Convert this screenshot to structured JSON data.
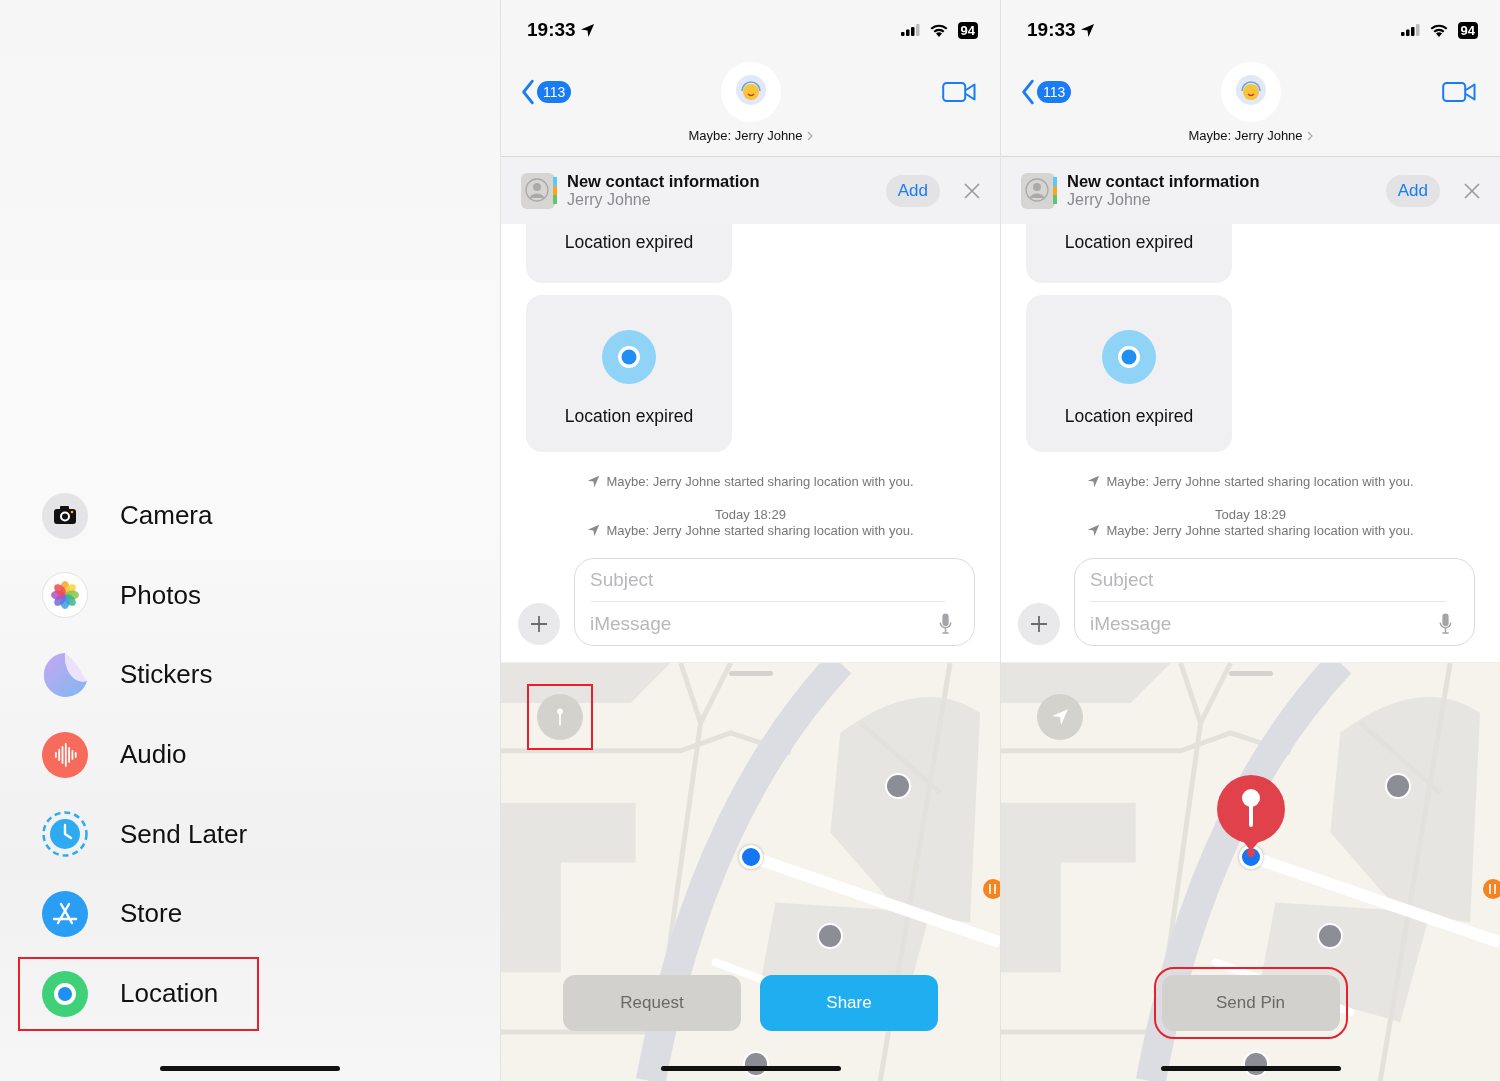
{
  "menu": {
    "items": [
      {
        "label": "Camera",
        "kind": "camera",
        "highlighted": false
      },
      {
        "label": "Photos",
        "kind": "photos",
        "highlighted": false
      },
      {
        "label": "Stickers",
        "kind": "stickers",
        "highlighted": false
      },
      {
        "label": "Audio",
        "kind": "audio",
        "highlighted": false
      },
      {
        "label": "Send Later",
        "kind": "later",
        "highlighted": false
      },
      {
        "label": "Store",
        "kind": "store",
        "highlighted": false
      },
      {
        "label": "Location",
        "kind": "location",
        "highlighted": true
      }
    ]
  },
  "screens": [
    {
      "status": {
        "time": "19:33",
        "battery": "94"
      },
      "nav": {
        "back_count": "113",
        "contact": "Maybe: Jerry Johne"
      },
      "banner": {
        "title": "New contact information",
        "subtitle": "Jerry Johne",
        "button": "Add"
      },
      "messages": [
        {
          "kind": "bubble",
          "text": "Location expired"
        },
        {
          "kind": "location",
          "text": "Location expired"
        },
        {
          "kind": "note",
          "text": "Maybe: Jerry Johne started sharing location with you."
        },
        {
          "kind": "timestamp",
          "text": "Today 18:29"
        },
        {
          "kind": "note",
          "text": "Maybe: Jerry Johne started sharing location with you."
        }
      ],
      "composer": {
        "subject_placeholder": "Subject",
        "placeholder": "iMessage"
      },
      "map": {
        "location_button": {
          "kind": "pin",
          "highlighted": true
        },
        "dropped_pin": false,
        "actions": [
          {
            "label": "Request",
            "kind": "secondary",
            "highlighted": false
          },
          {
            "label": "Share",
            "kind": "primary",
            "highlighted": false
          }
        ]
      }
    },
    {
      "status": {
        "time": "19:33",
        "battery": "94"
      },
      "nav": {
        "back_count": "113",
        "contact": "Maybe: Jerry Johne"
      },
      "banner": {
        "title": "New contact information",
        "subtitle": "Jerry Johne",
        "button": "Add"
      },
      "messages": [
        {
          "kind": "bubble",
          "text": "Location expired"
        },
        {
          "kind": "location",
          "text": "Location expired"
        },
        {
          "kind": "note",
          "text": "Maybe: Jerry Johne started sharing location with you."
        },
        {
          "kind": "timestamp",
          "text": "Today 18:29"
        },
        {
          "kind": "note",
          "text": "Maybe: Jerry Johne started sharing location with you."
        }
      ],
      "composer": {
        "subject_placeholder": "Subject",
        "placeholder": "iMessage"
      },
      "map": {
        "location_button": {
          "kind": "arrow",
          "highlighted": false
        },
        "dropped_pin": true,
        "actions": [
          {
            "label": "Send Pin",
            "kind": "secondary",
            "highlighted": true
          }
        ]
      }
    }
  ]
}
